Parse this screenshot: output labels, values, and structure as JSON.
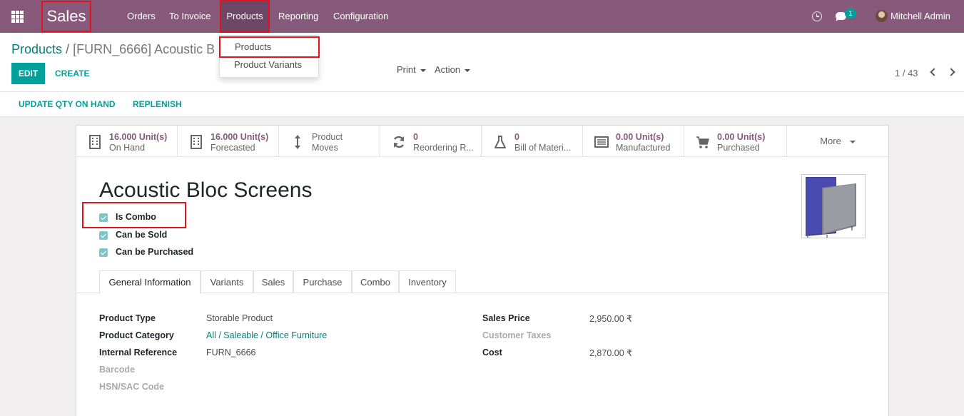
{
  "navbar": {
    "brand": "Sales",
    "menu": [
      "Orders",
      "To Invoice",
      "Products",
      "Reporting",
      "Configuration"
    ],
    "chat_count": "1",
    "user": "Mitchell Admin"
  },
  "products_dropdown": [
    "Products",
    "Product Variants"
  ],
  "breadcrumb": {
    "parent": "Products",
    "separator": "/",
    "current": "[FURN_6666] Acoustic B"
  },
  "control_panel": {
    "edit": "EDIT",
    "create": "CREATE",
    "print": "Print",
    "action": "Action",
    "pager": "1 / 43"
  },
  "action_bar": {
    "update_qty": "UPDATE QTY ON HAND",
    "replenish": "REPLENISH"
  },
  "stat_buttons": [
    {
      "value": "16.000 Unit(s)",
      "label": "On Hand",
      "icon": "building-icon"
    },
    {
      "value": "16.000 Unit(s)",
      "label": "Forecasted",
      "icon": "building-icon"
    },
    {
      "line1": "Product",
      "line2": "Moves",
      "icon": "up-down-arrow-icon"
    },
    {
      "value": "0",
      "label": "Reordering R...",
      "icon": "refresh-icon"
    },
    {
      "value": "0",
      "label": "Bill of Materi...",
      "icon": "flask-icon"
    },
    {
      "value": "0.00 Unit(s)",
      "label": "Manufactured",
      "icon": "list-icon"
    },
    {
      "value": "0.00 Unit(s)",
      "label": "Purchased",
      "icon": "cart-icon"
    }
  ],
  "more": "More",
  "product": {
    "title": "Acoustic Bloc Screens",
    "checkboxes": [
      {
        "label": "Is Combo",
        "checked": true
      },
      {
        "label": "Can be Sold",
        "checked": true
      },
      {
        "label": "Can be Purchased",
        "checked": true
      }
    ]
  },
  "tabs": [
    "General Information",
    "Variants",
    "Sales",
    "Purchase",
    "Combo",
    "Inventory"
  ],
  "general_info": {
    "left": [
      {
        "label": "Product Type",
        "value": "Storable Product"
      },
      {
        "label": "Product Category",
        "value": "All / Saleable / Office Furniture"
      },
      {
        "label": "Internal Reference",
        "value": "FURN_6666"
      },
      {
        "label": "Barcode",
        "value": ""
      },
      {
        "label": "HSN/SAC Code",
        "value": ""
      }
    ],
    "right": [
      {
        "label": "Sales Price",
        "value": "2,950.00 ₹"
      },
      {
        "label": "Customer Taxes",
        "value": ""
      },
      {
        "label": "Cost",
        "value": "2,870.00 ₹"
      }
    ]
  },
  "colors": {
    "navbar": "#875a7b",
    "primary": "#00a09d",
    "highlight": "#e0151b"
  }
}
